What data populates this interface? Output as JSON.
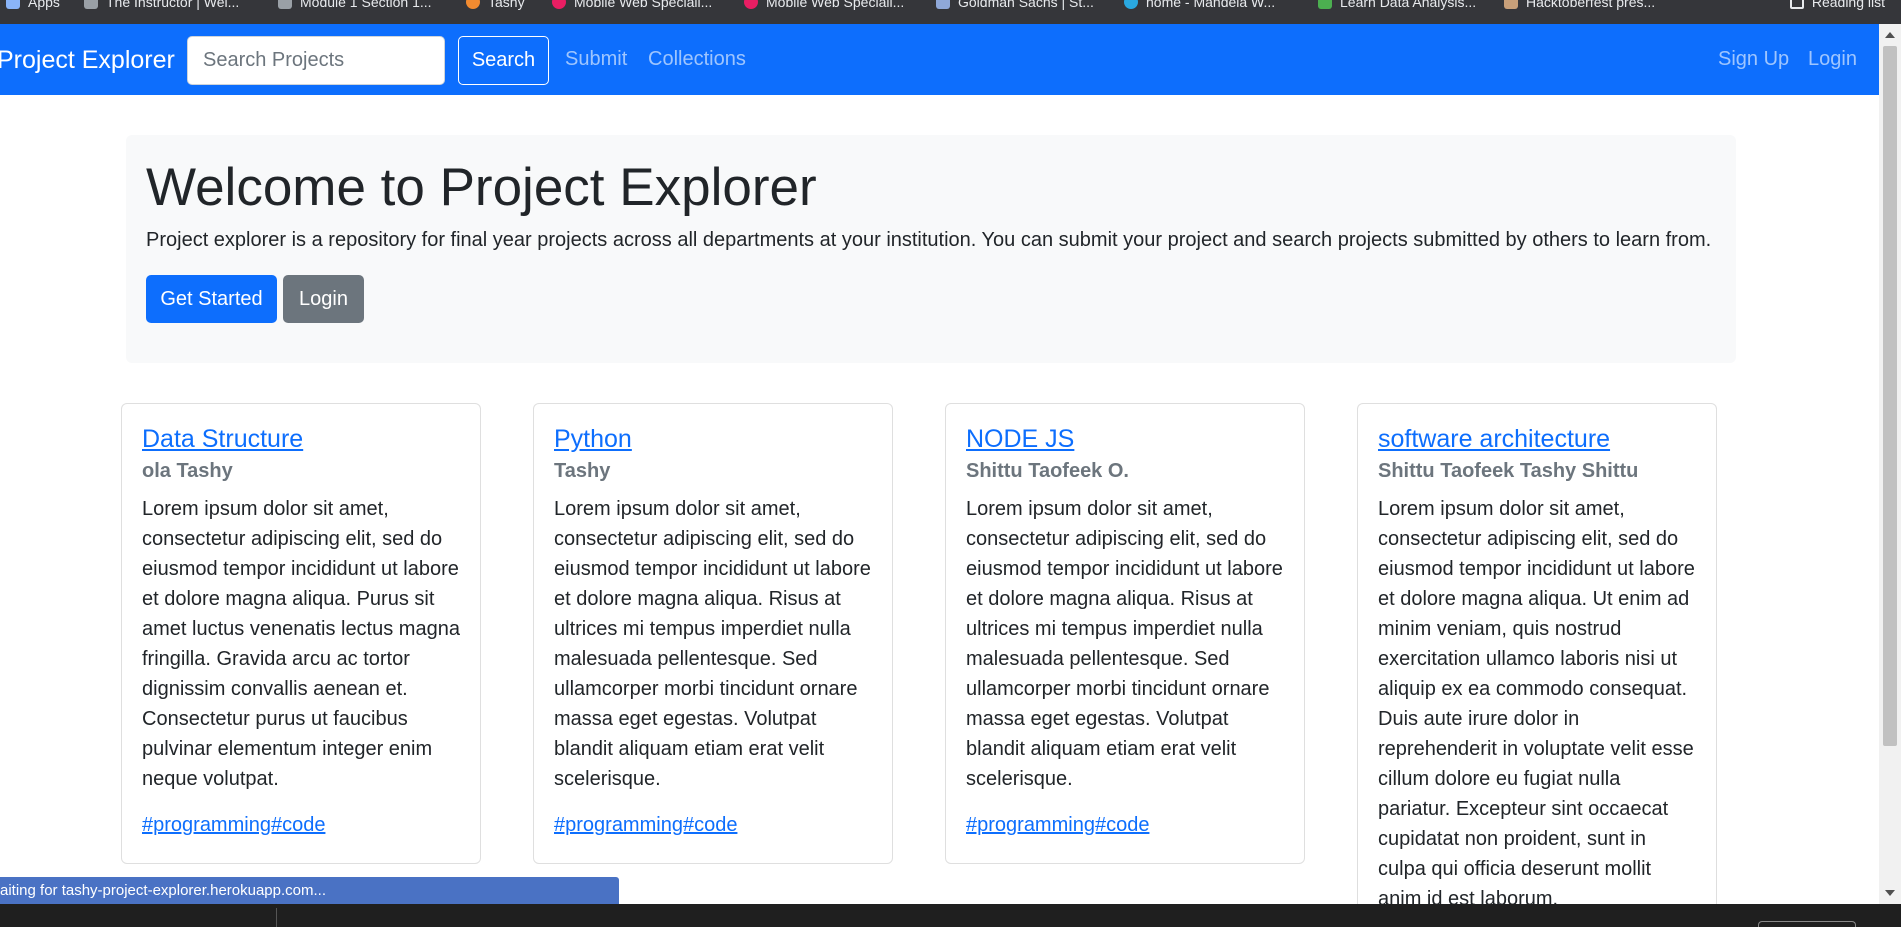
{
  "bookmarks": {
    "items": [
      {
        "label": "Apps",
        "icon": "apps-grid-icon",
        "color": "#8ab4f8"
      },
      {
        "label": "The Instructor | Wel...",
        "icon": "edx-icon",
        "color": "#9aa0a6"
      },
      {
        "label": "Module 1 Section 1...",
        "icon": "edx-icon",
        "color": "#9aa0a6"
      },
      {
        "label": "Tashy",
        "icon": "smile-icon",
        "color": "#f28b30"
      },
      {
        "label": "Mobile Web Speciali...",
        "icon": "udacity-icon",
        "color": "#e91e63"
      },
      {
        "label": "Mobile Web Speciali...",
        "icon": "udacity-icon",
        "color": "#e91e63"
      },
      {
        "label": "Goldman Sachs | St...",
        "icon": "doc-icon",
        "color": "#8fa8d8"
      },
      {
        "label": "home - Mandela W...",
        "icon": "yali-icon",
        "color": "#2aa8e0"
      },
      {
        "label": "Learn Data Analysis...",
        "icon": "dollar-icon",
        "color": "#4caf50"
      },
      {
        "label": "Hacktoberfest pres...",
        "icon": "hacktoberfest-icon",
        "color": "#c8a07a"
      }
    ],
    "reading_list": "Reading list"
  },
  "navbar": {
    "brand": "Project Explorer",
    "search_placeholder": "Search Projects",
    "search_button": "Search",
    "links": [
      "Submit",
      "Collections"
    ],
    "right_links": [
      "Sign Up",
      "Login"
    ]
  },
  "jumbotron": {
    "title": "Welcome to Project Explorer",
    "description": "Project explorer is a repository for final year projects across all departments at your institution. You can submit your project and search projects submitted by others to learn from.",
    "primary_button": "Get Started",
    "secondary_button": "Login"
  },
  "projects": [
    {
      "title": "Data Structure",
      "author": "ola Tashy",
      "text": "Lorem ipsum dolor sit amet, consectetur adipiscing elit, sed do eiusmod tempor incididunt ut labore et dolore magna aliqua. Purus sit amet luctus venenatis lectus magna fringilla. Gravida arcu ac tortor dignissim convallis aenean et. Consectetur purus ut faucibus pulvinar elementum integer enim neque volutpat.",
      "tags": "#programming#code"
    },
    {
      "title": "Python",
      "author": "Tashy",
      "text": "Lorem ipsum dolor sit amet, consectetur adipiscing elit, sed do eiusmod tempor incididunt ut labore et dolore magna aliqua. Risus at ultrices mi tempus imperdiet nulla malesuada pellentesque. Sed ullamcorper morbi tincidunt ornare massa eget egestas. Volutpat blandit aliquam etiam erat velit scelerisque.",
      "tags": "#programming#code"
    },
    {
      "title": "NODE JS",
      "author": "Shittu Taofeek O.",
      "text": "Lorem ipsum dolor sit amet, consectetur adipiscing elit, sed do eiusmod tempor incididunt ut labore et dolore magna aliqua. Risus at ultrices mi tempus imperdiet nulla malesuada pellentesque. Sed ullamcorper morbi tincidunt ornare massa eget egestas. Volutpat blandit aliquam etiam erat velit scelerisque.",
      "tags": "#programming#code"
    },
    {
      "title": "software architecture",
      "author": "Shittu Taofeek Tashy Shittu",
      "text": "Lorem ipsum dolor sit amet, consectetur adipiscing elit, sed do eiusmod tempor incididunt ut labore et dolore magna aliqua. Ut enim ad minim veniam, quis nostrud exercitation ullamco laboris nisi ut aliquip ex ea commodo consequat. Duis aute irure dolor in reprehenderit in voluptate velit esse cillum dolore eu fugiat nulla pariatur. Excepteur sint occaecat cupidatat non proident, sunt in culpa qui officia deserunt mollit anim id est laborum.",
      "tags": ""
    }
  ],
  "status_bar": "aiting for tashy-project-explorer.herokuapp.com...",
  "colors": {
    "primary": "#0d6efd",
    "secondary": "#6c757d",
    "jumbotron_bg": "#f8f9fa",
    "bookmarks_bg": "#35363a",
    "status_bg": "#4a72c4"
  }
}
